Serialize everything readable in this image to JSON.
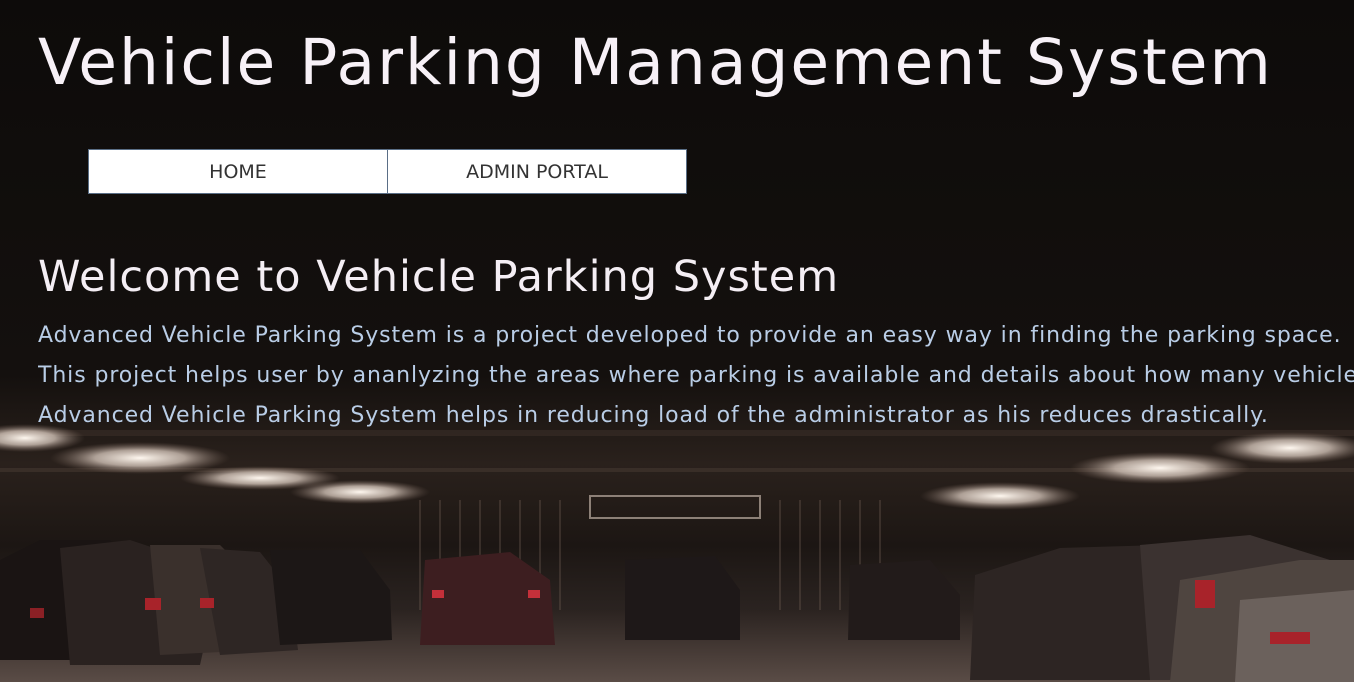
{
  "site": {
    "title": "Vehicle Parking Management System"
  },
  "nav": {
    "items": [
      {
        "label": "HOME"
      },
      {
        "label": "ADMIN PORTAL"
      }
    ]
  },
  "main": {
    "heading": "Welcome to Vehicle Parking System",
    "paragraphs": [
      "Advanced Vehicle Parking System is a project developed to provide an easy way in finding the parking space.",
      "This project helps user by ananlyzing the areas where parking is available and details about how many vehicles.",
      "Advanced Vehicle Parking System helps in reducing load of the administrator as his reduces drastically."
    ]
  },
  "background": {
    "image": "parking-garage-photo",
    "dark_color": "#0e0b0a",
    "light_color": "#e8dcd4",
    "accent_color": "#a8232a"
  }
}
